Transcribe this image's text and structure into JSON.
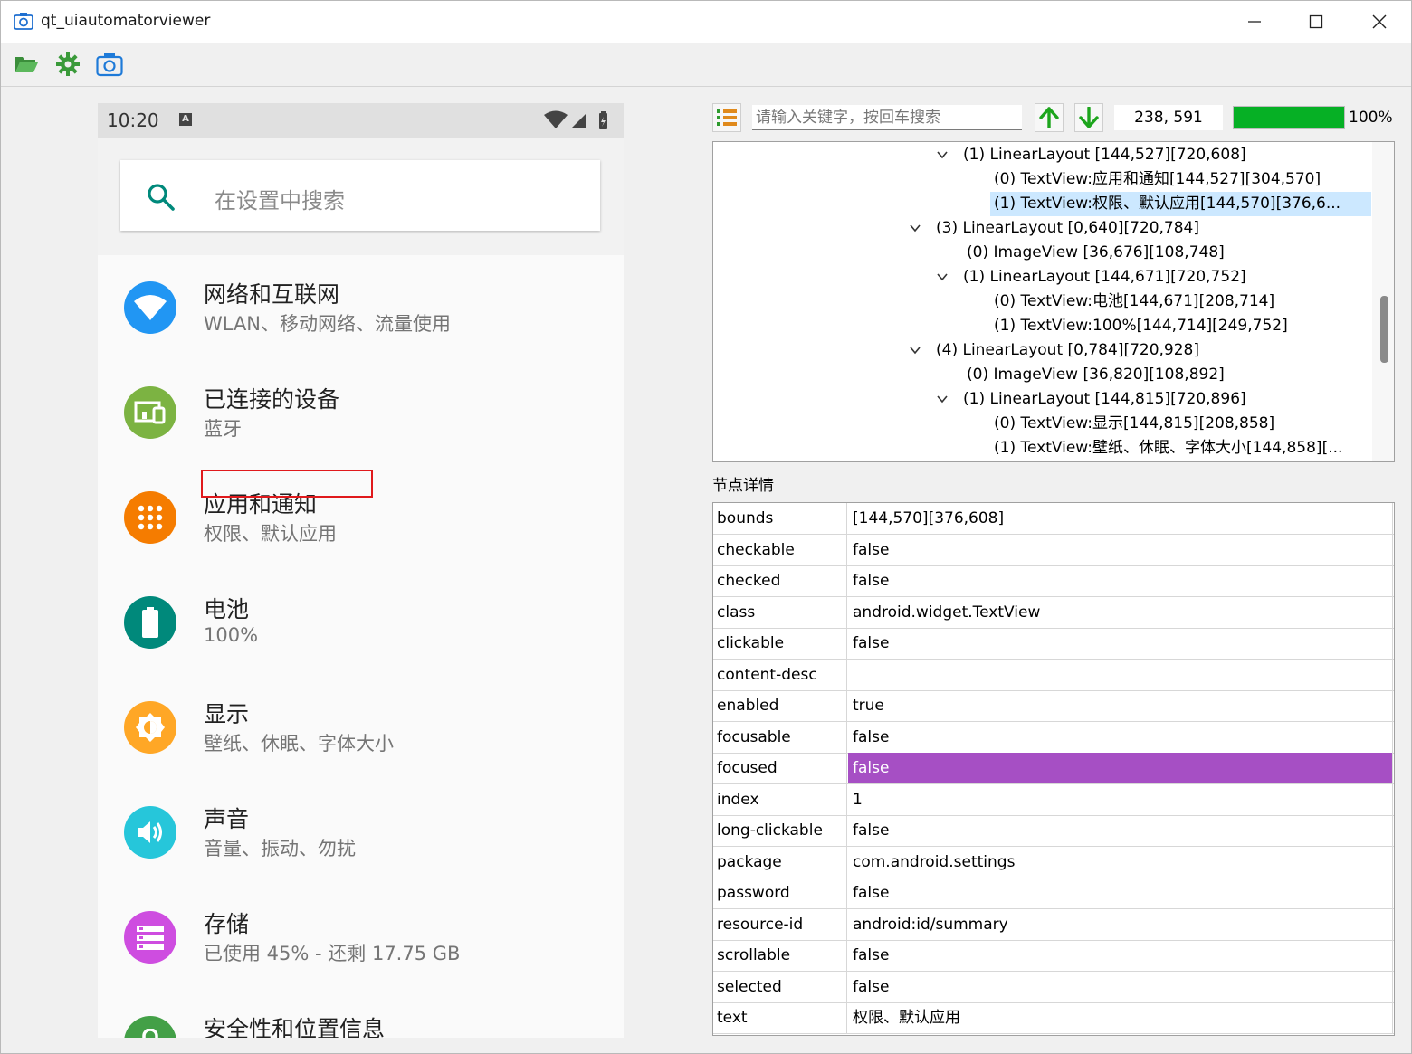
{
  "window": {
    "title": "qt_uiautomatorviewer"
  },
  "toolbar": {
    "icons": [
      "folder-open-icon",
      "settings-gear-icon",
      "screenshot-camera-icon"
    ]
  },
  "phone": {
    "time": "10:20",
    "notification_badge": "A",
    "search_placeholder": "在设置中搜索",
    "items": [
      {
        "title": "网络和互联网",
        "subtitle": "WLAN、移动网络、流量使用",
        "icon": "wifi-icon",
        "color": "#2196f3"
      },
      {
        "title": "已连接的设备",
        "subtitle": "蓝牙",
        "icon": "devices-icon",
        "color": "#7cb342"
      },
      {
        "title": "应用和通知",
        "subtitle": "权限、默认应用",
        "icon": "apps-icon",
        "color": "#f57c00"
      },
      {
        "title": "电池",
        "subtitle": "100%",
        "icon": "battery-icon",
        "color": "#00897b"
      },
      {
        "title": "显示",
        "subtitle": "壁纸、休眠、字体大小",
        "icon": "brightness-icon",
        "color": "#ffa726"
      },
      {
        "title": "声音",
        "subtitle": "音量、振动、勿扰",
        "icon": "volume-icon",
        "color": "#26c6da"
      },
      {
        "title": "存储",
        "subtitle": "已使用 45% - 还剩 17.75 GB",
        "icon": "storage-icon",
        "color": "#ce4de0"
      },
      {
        "title": "安全性和位置信息",
        "subtitle": "",
        "icon": "lock-icon",
        "color": "#43a047"
      }
    ]
  },
  "inspector": {
    "search_placeholder": "请输入关键字，按回车搜索",
    "coords": "238, 591",
    "progress_percent": 100,
    "progress_label": "100%",
    "tree": [
      {
        "indent": 3,
        "expanded": true,
        "text": "(1) LinearLayout [144,527][720,608]"
      },
      {
        "indent": 4,
        "expanded": false,
        "text": "(0) TextView:应用和通知[144,527][304,570]"
      },
      {
        "indent": 4,
        "expanded": false,
        "text": "(1) TextView:权限、默认应用[144,570][376,6...",
        "selected": true
      },
      {
        "indent": 2,
        "expanded": true,
        "text": "(3) LinearLayout [0,640][720,784]"
      },
      {
        "indent": 3,
        "expanded": false,
        "text": "(0) ImageView [36,676][108,748]"
      },
      {
        "indent": 3,
        "expanded": true,
        "text": "(1) LinearLayout [144,671][720,752]"
      },
      {
        "indent": 4,
        "expanded": false,
        "text": "(0) TextView:电池[144,671][208,714]"
      },
      {
        "indent": 4,
        "expanded": false,
        "text": "(1) TextView:100%[144,714][249,752]"
      },
      {
        "indent": 2,
        "expanded": true,
        "text": "(4) LinearLayout [0,784][720,928]"
      },
      {
        "indent": 3,
        "expanded": false,
        "text": "(0) ImageView [36,820][108,892]"
      },
      {
        "indent": 3,
        "expanded": true,
        "text": "(1) LinearLayout [144,815][720,896]"
      },
      {
        "indent": 4,
        "expanded": false,
        "text": "(0) TextView:显示[144,815][208,858]"
      },
      {
        "indent": 4,
        "expanded": false,
        "text": "(1) TextView:壁纸、休眠、字体大小[144,858][..."
      }
    ],
    "details_label": "节点详情",
    "details": [
      {
        "key": "bounds",
        "value": "[144,570][376,608]"
      },
      {
        "key": "checkable",
        "value": "false"
      },
      {
        "key": "checked",
        "value": "false"
      },
      {
        "key": "class",
        "value": "android.widget.TextView"
      },
      {
        "key": "clickable",
        "value": "false"
      },
      {
        "key": "content-desc",
        "value": ""
      },
      {
        "key": "enabled",
        "value": "true"
      },
      {
        "key": "focusable",
        "value": "false"
      },
      {
        "key": "focused",
        "value": "false",
        "selected": true
      },
      {
        "key": "index",
        "value": "1"
      },
      {
        "key": "long-clickable",
        "value": "false"
      },
      {
        "key": "package",
        "value": "com.android.settings"
      },
      {
        "key": "password",
        "value": "false"
      },
      {
        "key": "resource-id",
        "value": "android:id/summary"
      },
      {
        "key": "scrollable",
        "value": "false"
      },
      {
        "key": "selected",
        "value": "false"
      },
      {
        "key": "text",
        "value": "权限、默认应用"
      }
    ]
  }
}
